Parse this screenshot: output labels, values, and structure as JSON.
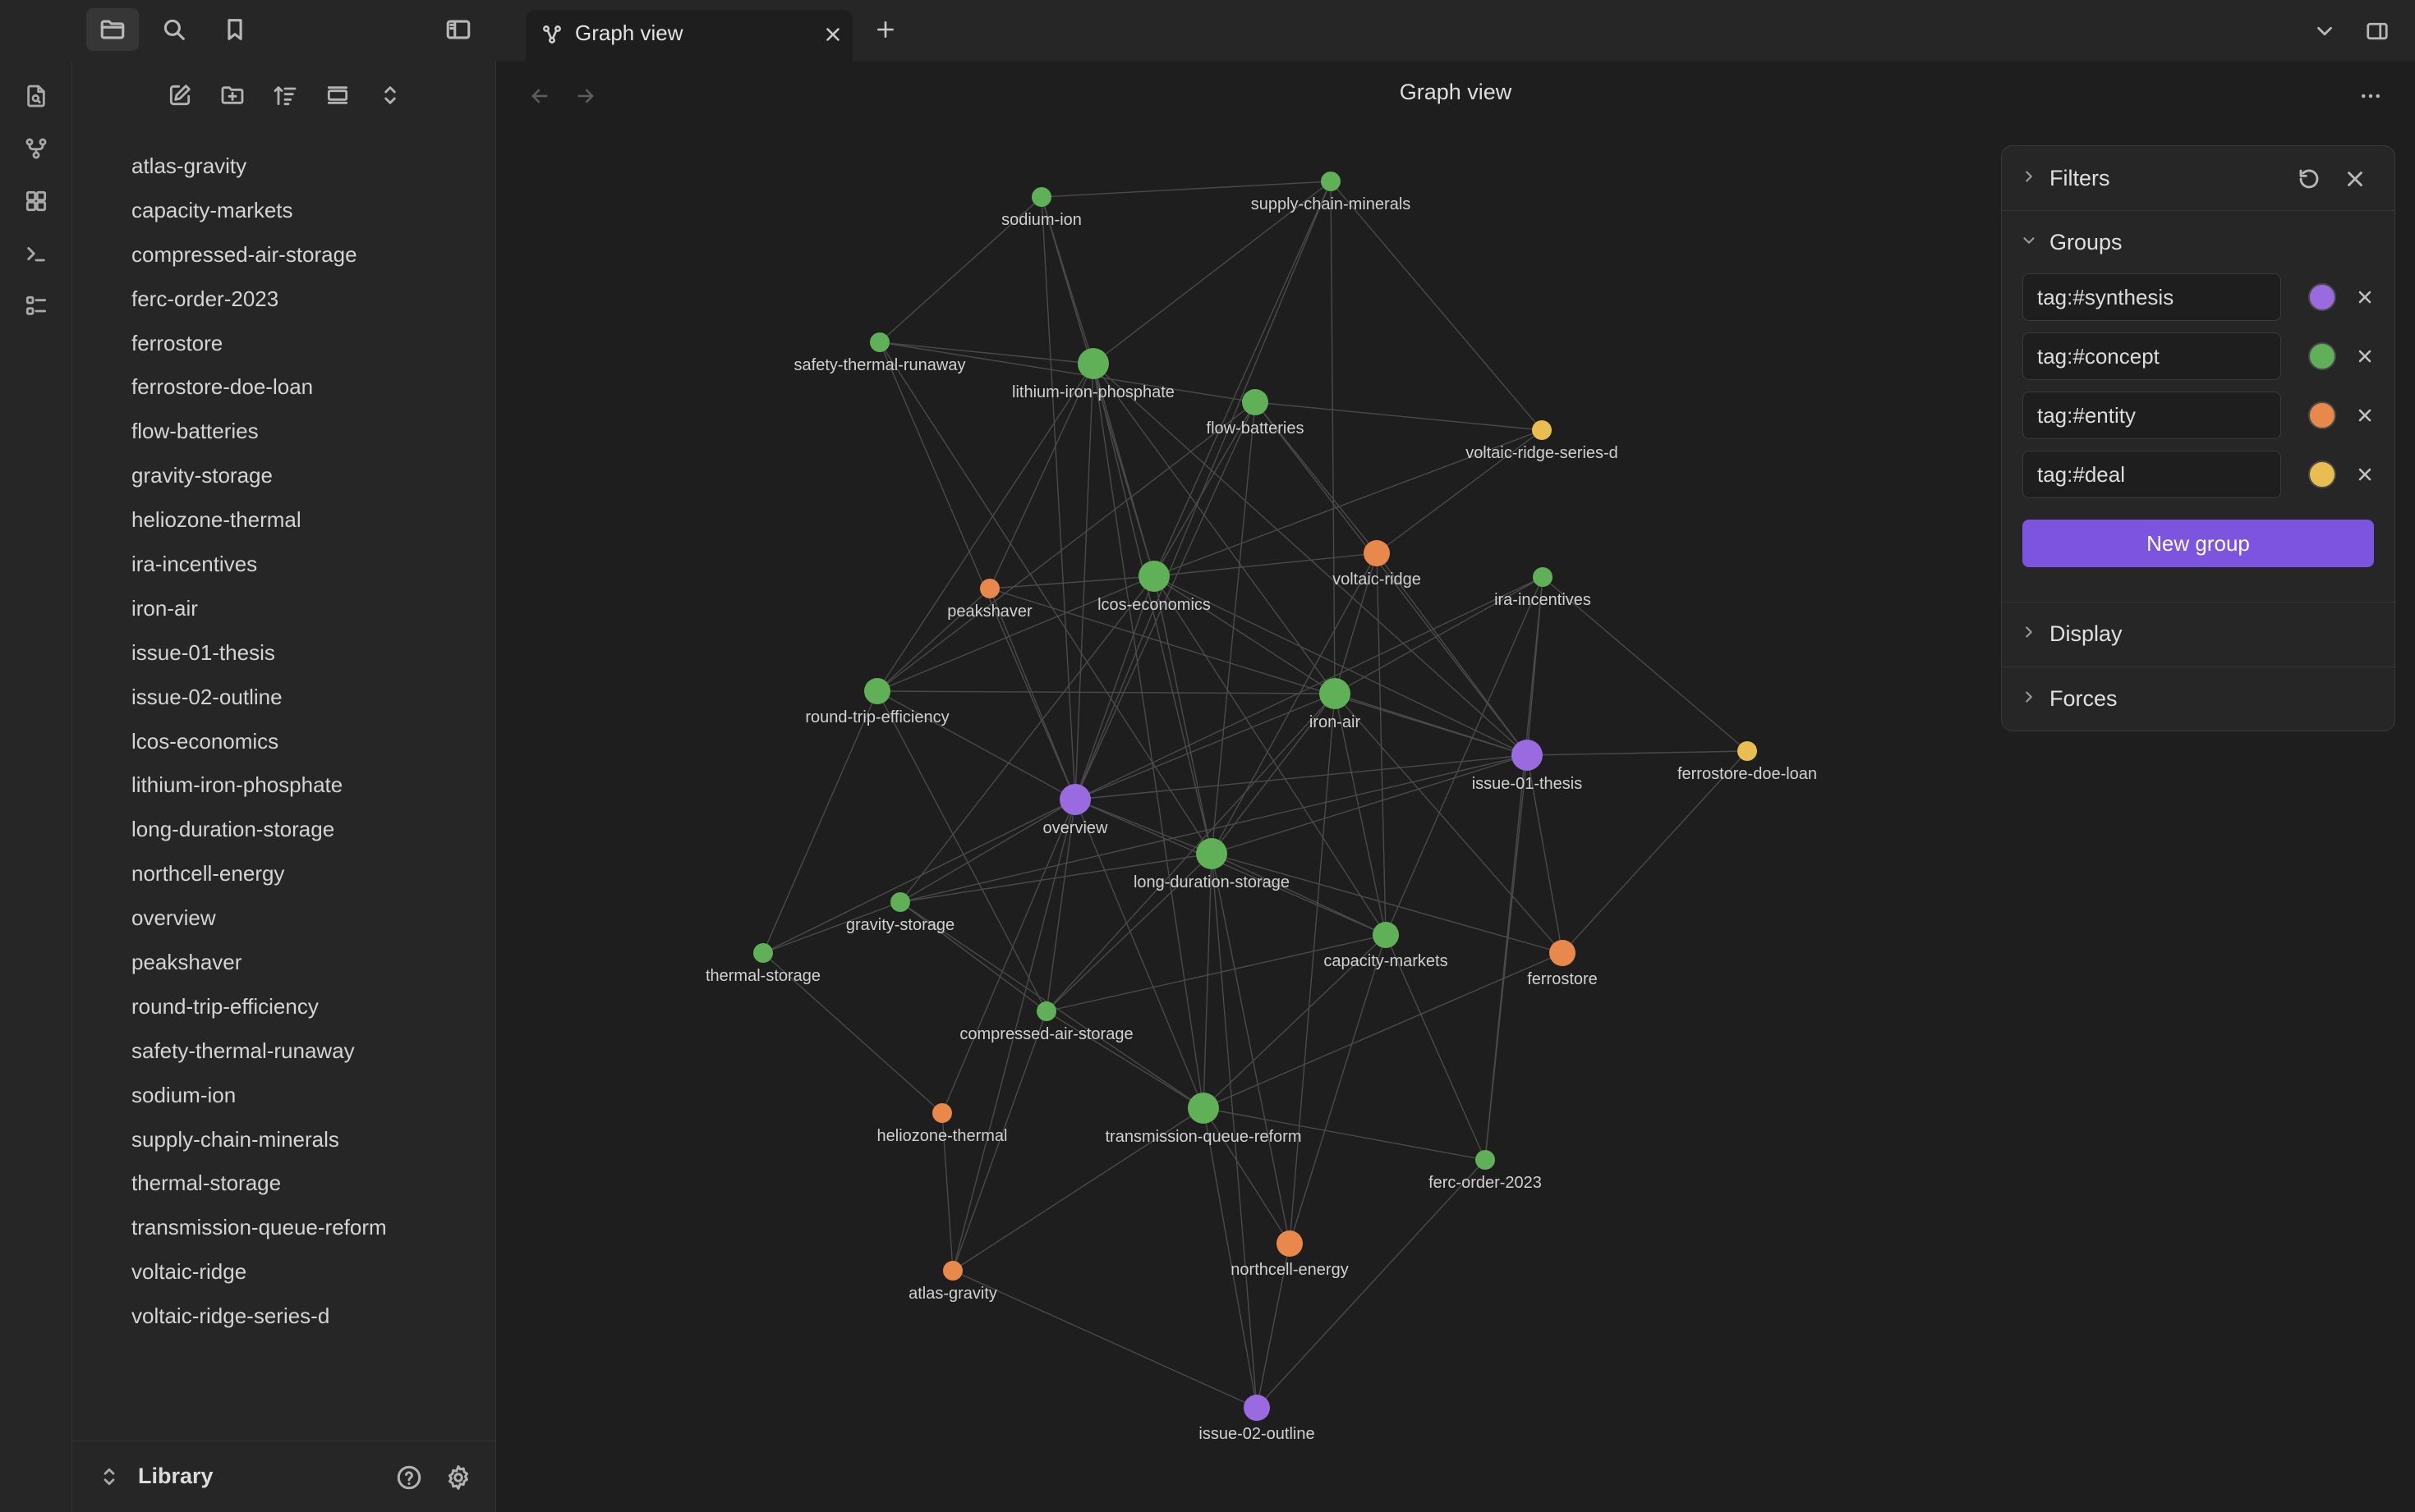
{
  "tab": {
    "title": "Graph view"
  },
  "main": {
    "title": "Graph view"
  },
  "sidebar": {
    "vault_name": "Library",
    "files": [
      "atlas-gravity",
      "capacity-markets",
      "compressed-air-storage",
      "ferc-order-2023",
      "ferrostore",
      "ferrostore-doe-loan",
      "flow-batteries",
      "gravity-storage",
      "heliozone-thermal",
      "ira-incentives",
      "iron-air",
      "issue-01-thesis",
      "issue-02-outline",
      "lcos-economics",
      "lithium-iron-phosphate",
      "long-duration-storage",
      "northcell-energy",
      "overview",
      "peakshaver",
      "round-trip-efficiency",
      "safety-thermal-runaway",
      "sodium-ion",
      "supply-chain-minerals",
      "thermal-storage",
      "transmission-queue-reform",
      "voltaic-ridge",
      "voltaic-ridge-series-d"
    ]
  },
  "panel": {
    "filters_label": "Filters",
    "groups_label": "Groups",
    "display_label": "Display",
    "forces_label": "Forces",
    "new_group_label": "New group",
    "groups": [
      {
        "query": "tag:#synthesis",
        "color": "#9a6be0"
      },
      {
        "query": "tag:#concept",
        "color": "#5fb057"
      },
      {
        "query": "tag:#entity",
        "color": "#e8884a"
      },
      {
        "query": "tag:#deal",
        "color": "#e9bd50"
      }
    ]
  },
  "graph": {
    "nodes": [
      {
        "id": "sodium-ion",
        "label": "sodium-ion",
        "group": "concept",
        "size": "small"
      },
      {
        "id": "supply-chain-minerals",
        "label": "supply-chain-minerals",
        "group": "concept",
        "size": "small"
      },
      {
        "id": "safety-thermal-runaway",
        "label": "safety-thermal-runaway",
        "group": "concept",
        "size": "small"
      },
      {
        "id": "lithium-iron-phosphate",
        "label": "lithium-iron-phosphate",
        "group": "concept",
        "size": "large"
      },
      {
        "id": "flow-batteries",
        "label": "flow-batteries",
        "group": "concept",
        "size": "medium"
      },
      {
        "id": "voltaic-ridge-series-d",
        "label": "voltaic-ridge-series-d",
        "group": "deal",
        "size": "small"
      },
      {
        "id": "peakshaver",
        "label": "peakshaver",
        "group": "entity",
        "size": "small"
      },
      {
        "id": "lcos-economics",
        "label": "lcos-economics",
        "group": "concept",
        "size": "large"
      },
      {
        "id": "voltaic-ridge",
        "label": "voltaic-ridge",
        "group": "entity",
        "size": "medium"
      },
      {
        "id": "ira-incentives",
        "label": "ira-incentives",
        "group": "concept",
        "size": "small"
      },
      {
        "id": "round-trip-efficiency",
        "label": "round-trip-efficiency",
        "group": "concept",
        "size": "medium"
      },
      {
        "id": "iron-air",
        "label": "iron-air",
        "group": "concept",
        "size": "large"
      },
      {
        "id": "issue-01-thesis",
        "label": "issue-01-thesis",
        "group": "synthesis",
        "size": "large"
      },
      {
        "id": "ferrostore-doe-loan",
        "label": "ferrostore-doe-loan",
        "group": "deal",
        "size": "small"
      },
      {
        "id": "overview",
        "label": "overview",
        "group": "synthesis",
        "size": "large"
      },
      {
        "id": "long-duration-storage",
        "label": "long-duration-storage",
        "group": "concept",
        "size": "large"
      },
      {
        "id": "gravity-storage",
        "label": "gravity-storage",
        "group": "concept",
        "size": "small"
      },
      {
        "id": "thermal-storage",
        "label": "thermal-storage",
        "group": "concept",
        "size": "small"
      },
      {
        "id": "capacity-markets",
        "label": "capacity-markets",
        "group": "concept",
        "size": "medium"
      },
      {
        "id": "ferrostore",
        "label": "ferrostore",
        "group": "entity",
        "size": "medium"
      },
      {
        "id": "compressed-air-storage",
        "label": "compressed-air-storage",
        "group": "concept",
        "size": "small"
      },
      {
        "id": "heliozone-thermal",
        "label": "heliozone-thermal",
        "group": "entity",
        "size": "small"
      },
      {
        "id": "transmission-queue-reform",
        "label": "transmission-queue-reform",
        "group": "concept",
        "size": "large"
      },
      {
        "id": "ferc-order-2023",
        "label": "ferc-order-2023",
        "group": "concept",
        "size": "small"
      },
      {
        "id": "northcell-energy",
        "label": "northcell-energy",
        "group": "entity",
        "size": "medium"
      },
      {
        "id": "atlas-gravity",
        "label": "atlas-gravity",
        "group": "entity",
        "size": "small"
      },
      {
        "id": "issue-02-outline",
        "label": "issue-02-outline",
        "group": "synthesis",
        "size": "medium"
      }
    ],
    "edges": [
      [
        "sodium-ion",
        "supply-chain-minerals"
      ],
      [
        "sodium-ion",
        "safety-thermal-runaway"
      ],
      [
        "sodium-ion",
        "lithium-iron-phosphate"
      ],
      [
        "sodium-ion",
        "lcos-economics"
      ],
      [
        "sodium-ion",
        "overview"
      ],
      [
        "supply-chain-minerals",
        "lithium-iron-phosphate"
      ],
      [
        "supply-chain-minerals",
        "voltaic-ridge-series-d"
      ],
      [
        "supply-chain-minerals",
        "iron-air"
      ],
      [
        "supply-chain-minerals",
        "overview"
      ],
      [
        "supply-chain-minerals",
        "lcos-economics"
      ],
      [
        "safety-thermal-runaway",
        "lithium-iron-phosphate"
      ],
      [
        "safety-thermal-runaway",
        "flow-batteries"
      ],
      [
        "safety-thermal-runaway",
        "overview"
      ],
      [
        "safety-thermal-runaway",
        "long-duration-storage"
      ],
      [
        "lithium-iron-phosphate",
        "lcos-economics"
      ],
      [
        "lithium-iron-phosphate",
        "peakshaver"
      ],
      [
        "lithium-iron-phosphate",
        "overview"
      ],
      [
        "lithium-iron-phosphate",
        "iron-air"
      ],
      [
        "lithium-iron-phosphate",
        "issue-01-thesis"
      ],
      [
        "lithium-iron-phosphate",
        "round-trip-efficiency"
      ],
      [
        "lithium-iron-phosphate",
        "long-duration-storage"
      ],
      [
        "flow-batteries",
        "voltaic-ridge-series-d"
      ],
      [
        "flow-batteries",
        "lcos-economics"
      ],
      [
        "flow-batteries",
        "voltaic-ridge"
      ],
      [
        "flow-batteries",
        "overview"
      ],
      [
        "flow-batteries",
        "long-duration-storage"
      ],
      [
        "flow-batteries",
        "round-trip-efficiency"
      ],
      [
        "flow-batteries",
        "issue-01-thesis"
      ],
      [
        "voltaic-ridge-series-d",
        "voltaic-ridge"
      ],
      [
        "voltaic-ridge-series-d",
        "lcos-economics"
      ],
      [
        "peakshaver",
        "lcos-economics"
      ],
      [
        "peakshaver",
        "overview"
      ],
      [
        "peakshaver",
        "round-trip-efficiency"
      ],
      [
        "peakshaver",
        "issue-01-thesis"
      ],
      [
        "lcos-economics",
        "voltaic-ridge"
      ],
      [
        "lcos-economics",
        "iron-air"
      ],
      [
        "lcos-economics",
        "overview"
      ],
      [
        "lcos-economics",
        "long-duration-storage"
      ],
      [
        "lcos-economics",
        "issue-01-thesis"
      ],
      [
        "lcos-economics",
        "capacity-markets"
      ],
      [
        "lcos-economics",
        "round-trip-efficiency"
      ],
      [
        "lcos-economics",
        "gravity-storage"
      ],
      [
        "voltaic-ridge",
        "iron-air"
      ],
      [
        "voltaic-ridge",
        "issue-01-thesis"
      ],
      [
        "voltaic-ridge",
        "long-duration-storage"
      ],
      [
        "voltaic-ridge",
        "capacity-markets"
      ],
      [
        "ira-incentives",
        "iron-air"
      ],
      [
        "ira-incentives",
        "issue-01-thesis"
      ],
      [
        "ira-incentives",
        "capacity-markets"
      ],
      [
        "ira-incentives",
        "ferrostore-doe-loan"
      ],
      [
        "ira-incentives",
        "ferc-order-2023"
      ],
      [
        "ira-incentives",
        "overview"
      ],
      [
        "round-trip-efficiency",
        "iron-air"
      ],
      [
        "round-trip-efficiency",
        "thermal-storage"
      ],
      [
        "round-trip-efficiency",
        "compressed-air-storage"
      ],
      [
        "round-trip-efficiency",
        "overview"
      ],
      [
        "iron-air",
        "issue-01-thesis"
      ],
      [
        "iron-air",
        "overview"
      ],
      [
        "iron-air",
        "long-duration-storage"
      ],
      [
        "iron-air",
        "ferrostore"
      ],
      [
        "iron-air",
        "northcell-energy"
      ],
      [
        "iron-air",
        "capacity-markets"
      ],
      [
        "iron-air",
        "compressed-air-storage"
      ],
      [
        "issue-01-thesis",
        "ferrostore-doe-loan"
      ],
      [
        "issue-01-thesis",
        "long-duration-storage"
      ],
      [
        "issue-01-thesis",
        "ferrostore"
      ],
      [
        "issue-01-thesis",
        "ferc-order-2023"
      ],
      [
        "issue-01-thesis",
        "overview"
      ],
      [
        "issue-01-thesis",
        "gravity-storage"
      ],
      [
        "ferrostore-doe-loan",
        "ferrostore"
      ],
      [
        "overview",
        "long-duration-storage"
      ],
      [
        "overview",
        "gravity-storage"
      ],
      [
        "overview",
        "thermal-storage"
      ],
      [
        "overview",
        "compressed-air-storage"
      ],
      [
        "overview",
        "heliozone-thermal"
      ],
      [
        "overview",
        "transmission-queue-reform"
      ],
      [
        "overview",
        "capacity-markets"
      ],
      [
        "overview",
        "atlas-gravity"
      ],
      [
        "long-duration-storage",
        "gravity-storage"
      ],
      [
        "long-duration-storage",
        "capacity-markets"
      ],
      [
        "long-duration-storage",
        "ferrostore"
      ],
      [
        "long-duration-storage",
        "transmission-queue-reform"
      ],
      [
        "long-duration-storage",
        "compressed-air-storage"
      ],
      [
        "long-duration-storage",
        "northcell-energy"
      ],
      [
        "long-duration-storage",
        "issue-02-outline"
      ],
      [
        "gravity-storage",
        "thermal-storage"
      ],
      [
        "gravity-storage",
        "compressed-air-storage"
      ],
      [
        "gravity-storage",
        "transmission-queue-reform"
      ],
      [
        "thermal-storage",
        "heliozone-thermal"
      ],
      [
        "capacity-markets",
        "ferc-order-2023"
      ],
      [
        "capacity-markets",
        "transmission-queue-reform"
      ],
      [
        "capacity-markets",
        "compressed-air-storage"
      ],
      [
        "capacity-markets",
        "northcell-energy"
      ],
      [
        "ferrostore",
        "transmission-queue-reform"
      ],
      [
        "compressed-air-storage",
        "transmission-queue-reform"
      ],
      [
        "compressed-air-storage",
        "atlas-gravity"
      ],
      [
        "heliozone-thermal",
        "atlas-gravity"
      ],
      [
        "transmission-queue-reform",
        "ferc-order-2023"
      ],
      [
        "transmission-queue-reform",
        "northcell-energy"
      ],
      [
        "transmission-queue-reform",
        "atlas-gravity"
      ],
      [
        "transmission-queue-reform",
        "issue-02-outline"
      ],
      [
        "ferc-order-2023",
        "issue-02-outline"
      ],
      [
        "northcell-energy",
        "issue-02-outline"
      ],
      [
        "atlas-gravity",
        "issue-02-outline"
      ],
      [
        "lithium-iron-phosphate",
        "transmission-queue-reform"
      ]
    ]
  }
}
